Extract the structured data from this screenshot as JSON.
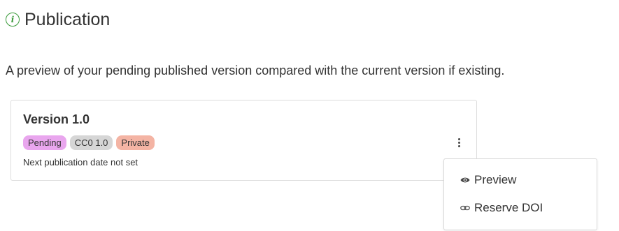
{
  "header": {
    "icon": "info-icon",
    "icon_glyph": "i",
    "title": "Publication",
    "accent_color": "#3a9a3a"
  },
  "description": "A preview of your pending published version compared with the current version if existing.",
  "card": {
    "version_title": "Version 1.0",
    "badges": [
      {
        "label": "Pending",
        "color": "#e9a6ee"
      },
      {
        "label": "CC0 1.0",
        "color": "#d6d6d6"
      },
      {
        "label": "Private",
        "color": "#f4b4a4"
      }
    ],
    "next_date_text": "Next publication date not set",
    "menu_trigger_icon": "kebab-menu-icon"
  },
  "menu": {
    "items": [
      {
        "label": "Preview",
        "icon": "eye-icon"
      },
      {
        "label": "Reserve DOI",
        "icon": "link-icon"
      }
    ]
  }
}
